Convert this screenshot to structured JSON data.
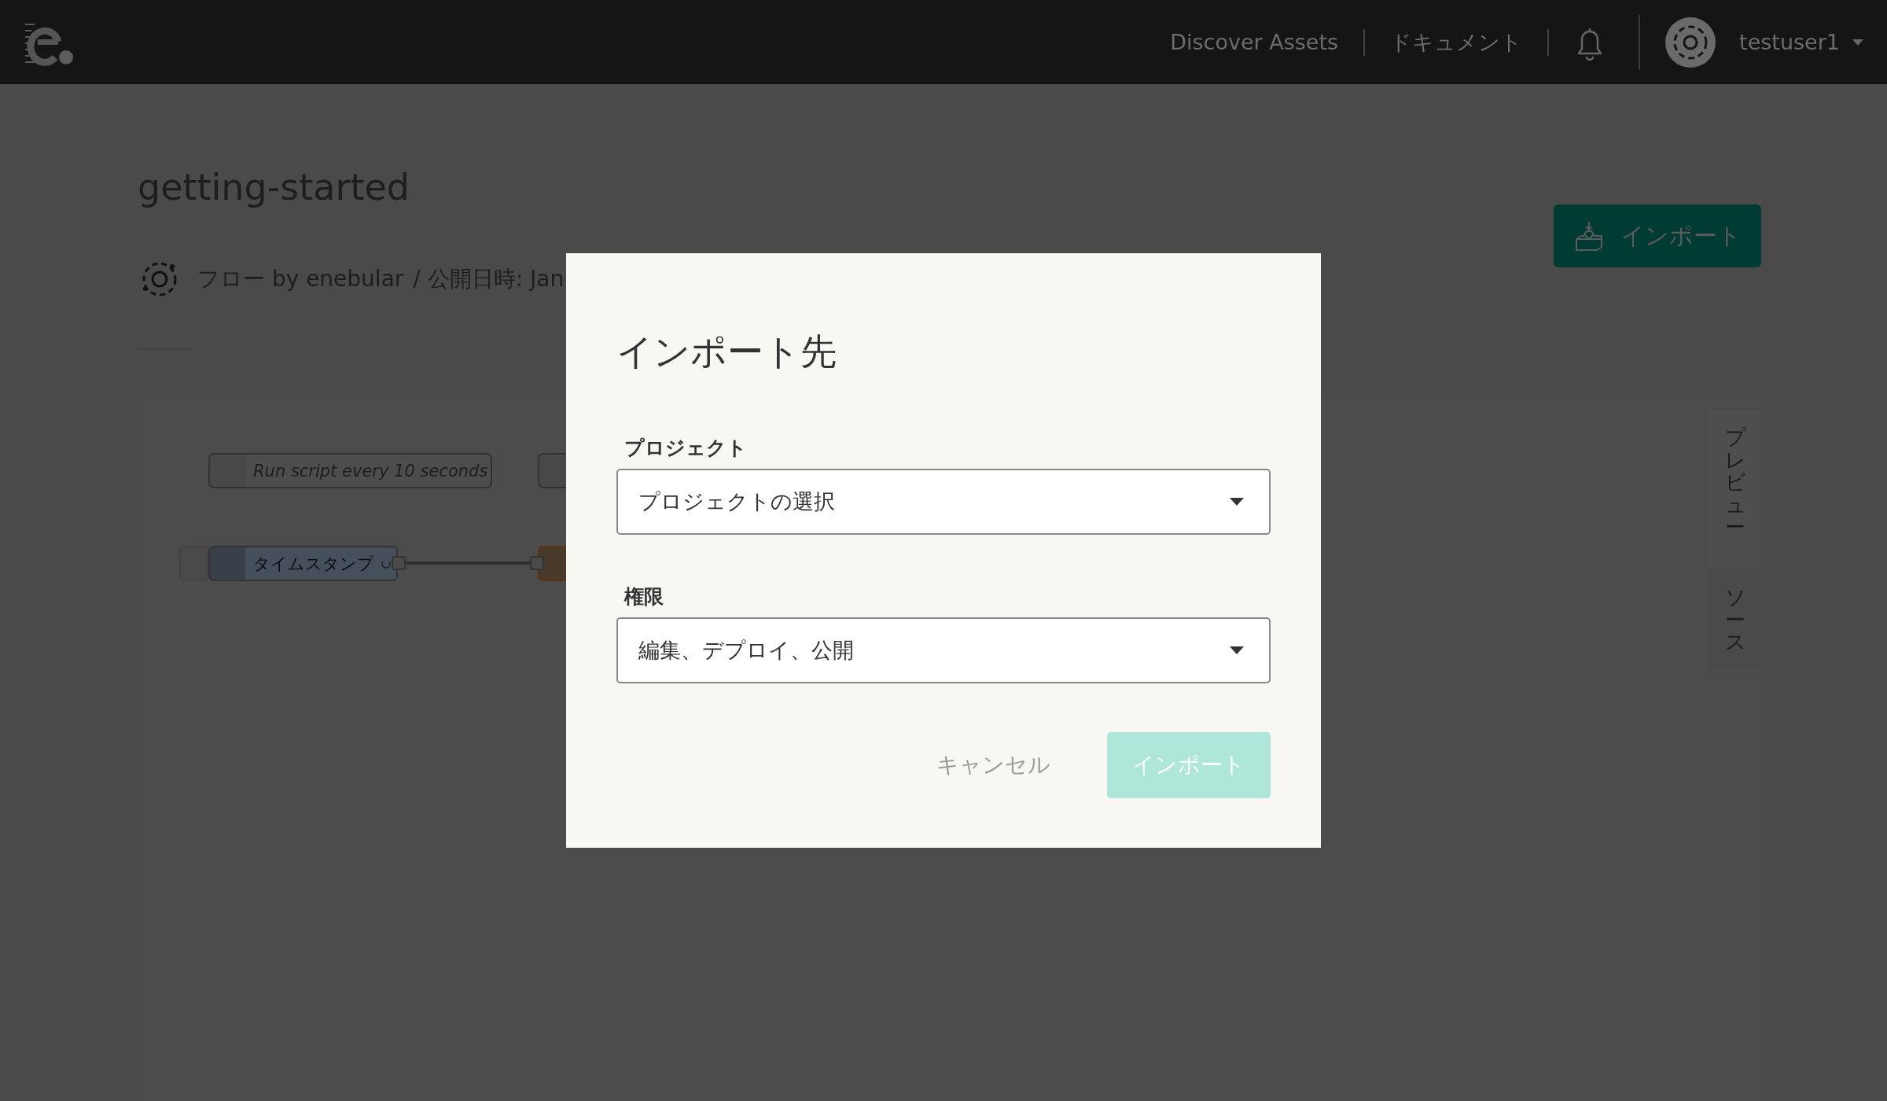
{
  "header": {
    "nav": [
      {
        "label": "Discover Assets"
      },
      {
        "label": "ドキュメント"
      }
    ],
    "user": {
      "name": "testuser1"
    }
  },
  "page": {
    "title": "getting-started",
    "meta": {
      "author": "フロー by enebular",
      "published": "/ 公開日時: Jan"
    },
    "import_button": "インポート",
    "canvas": {
      "nodes": [
        {
          "kind": "comment",
          "label": "Run script every 10 seconds"
        },
        {
          "kind": "comment"
        },
        {
          "kind": "inject",
          "label": "タイムスタンプ"
        },
        {
          "kind": "function"
        }
      ],
      "side_tabs": [
        {
          "label": "プレビュー",
          "selected": true
        },
        {
          "label": "ソース",
          "selected": false
        }
      ]
    }
  },
  "modal": {
    "title": "インポート先",
    "fields": [
      {
        "label": "プロジェクト",
        "value": "プロジェクトの選択"
      },
      {
        "label": "権限",
        "value": "編集、デプロイ、公開"
      }
    ],
    "buttons": [
      {
        "label": "キャンセル",
        "kind": "text",
        "disabled": false
      },
      {
        "label": "インポート",
        "kind": "primary",
        "disabled": true
      }
    ]
  }
}
